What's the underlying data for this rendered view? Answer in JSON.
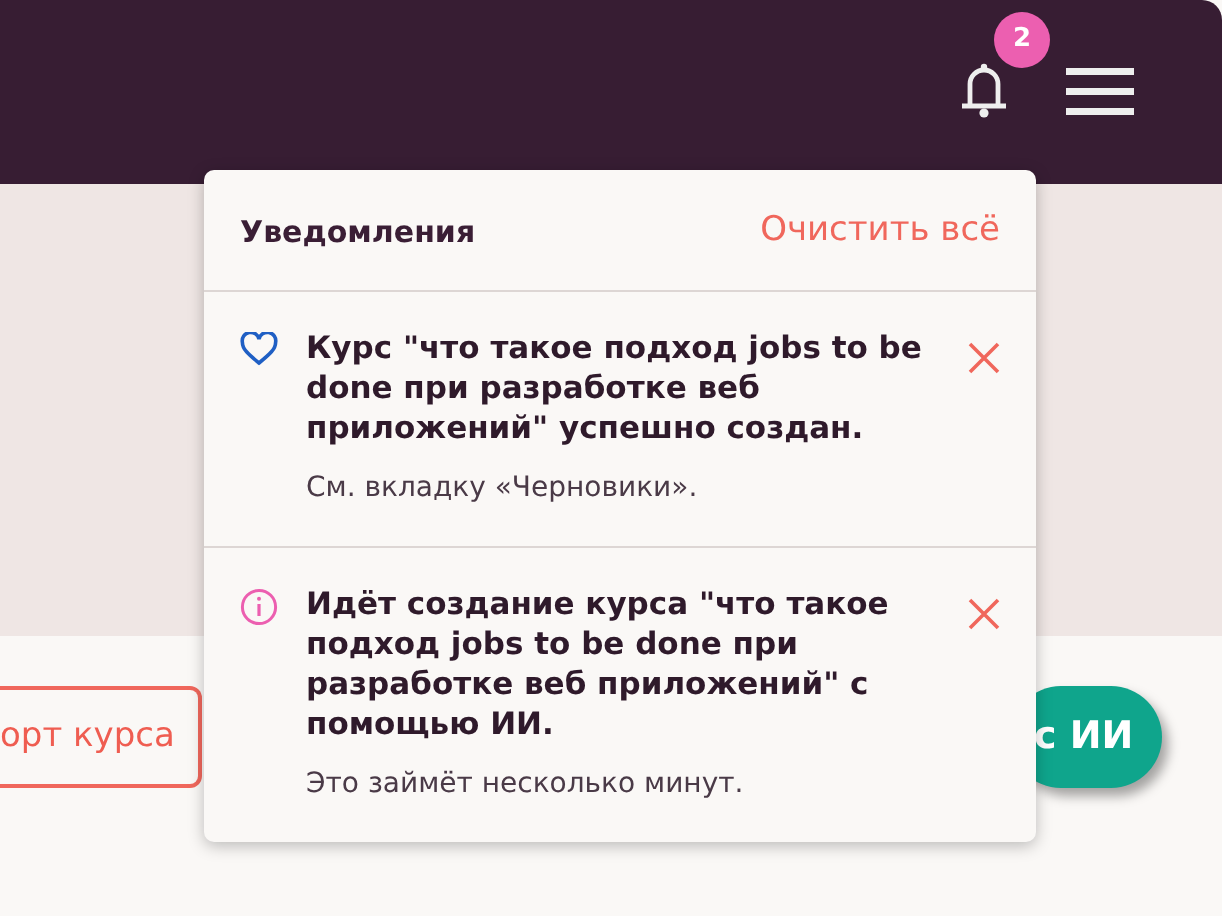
{
  "header": {
    "notification_count": "2"
  },
  "page": {
    "import_button": "орт курса",
    "ai_button": "с ИИ"
  },
  "notifications_panel": {
    "title": "Уведомления",
    "clear_all": "Очистить всё",
    "items": [
      {
        "kind": "success",
        "message": "Курс \"что такое подход jobs to be done при разработке веб приложений\" успешно создан.",
        "detail": "См. вкладку «Черновики»."
      },
      {
        "kind": "info",
        "message": "Идёт создание курса \"что такое подход jobs to be done при разработке веб приложений\" с помощью ИИ.",
        "detail": "Это займёт несколько минут."
      }
    ]
  }
}
